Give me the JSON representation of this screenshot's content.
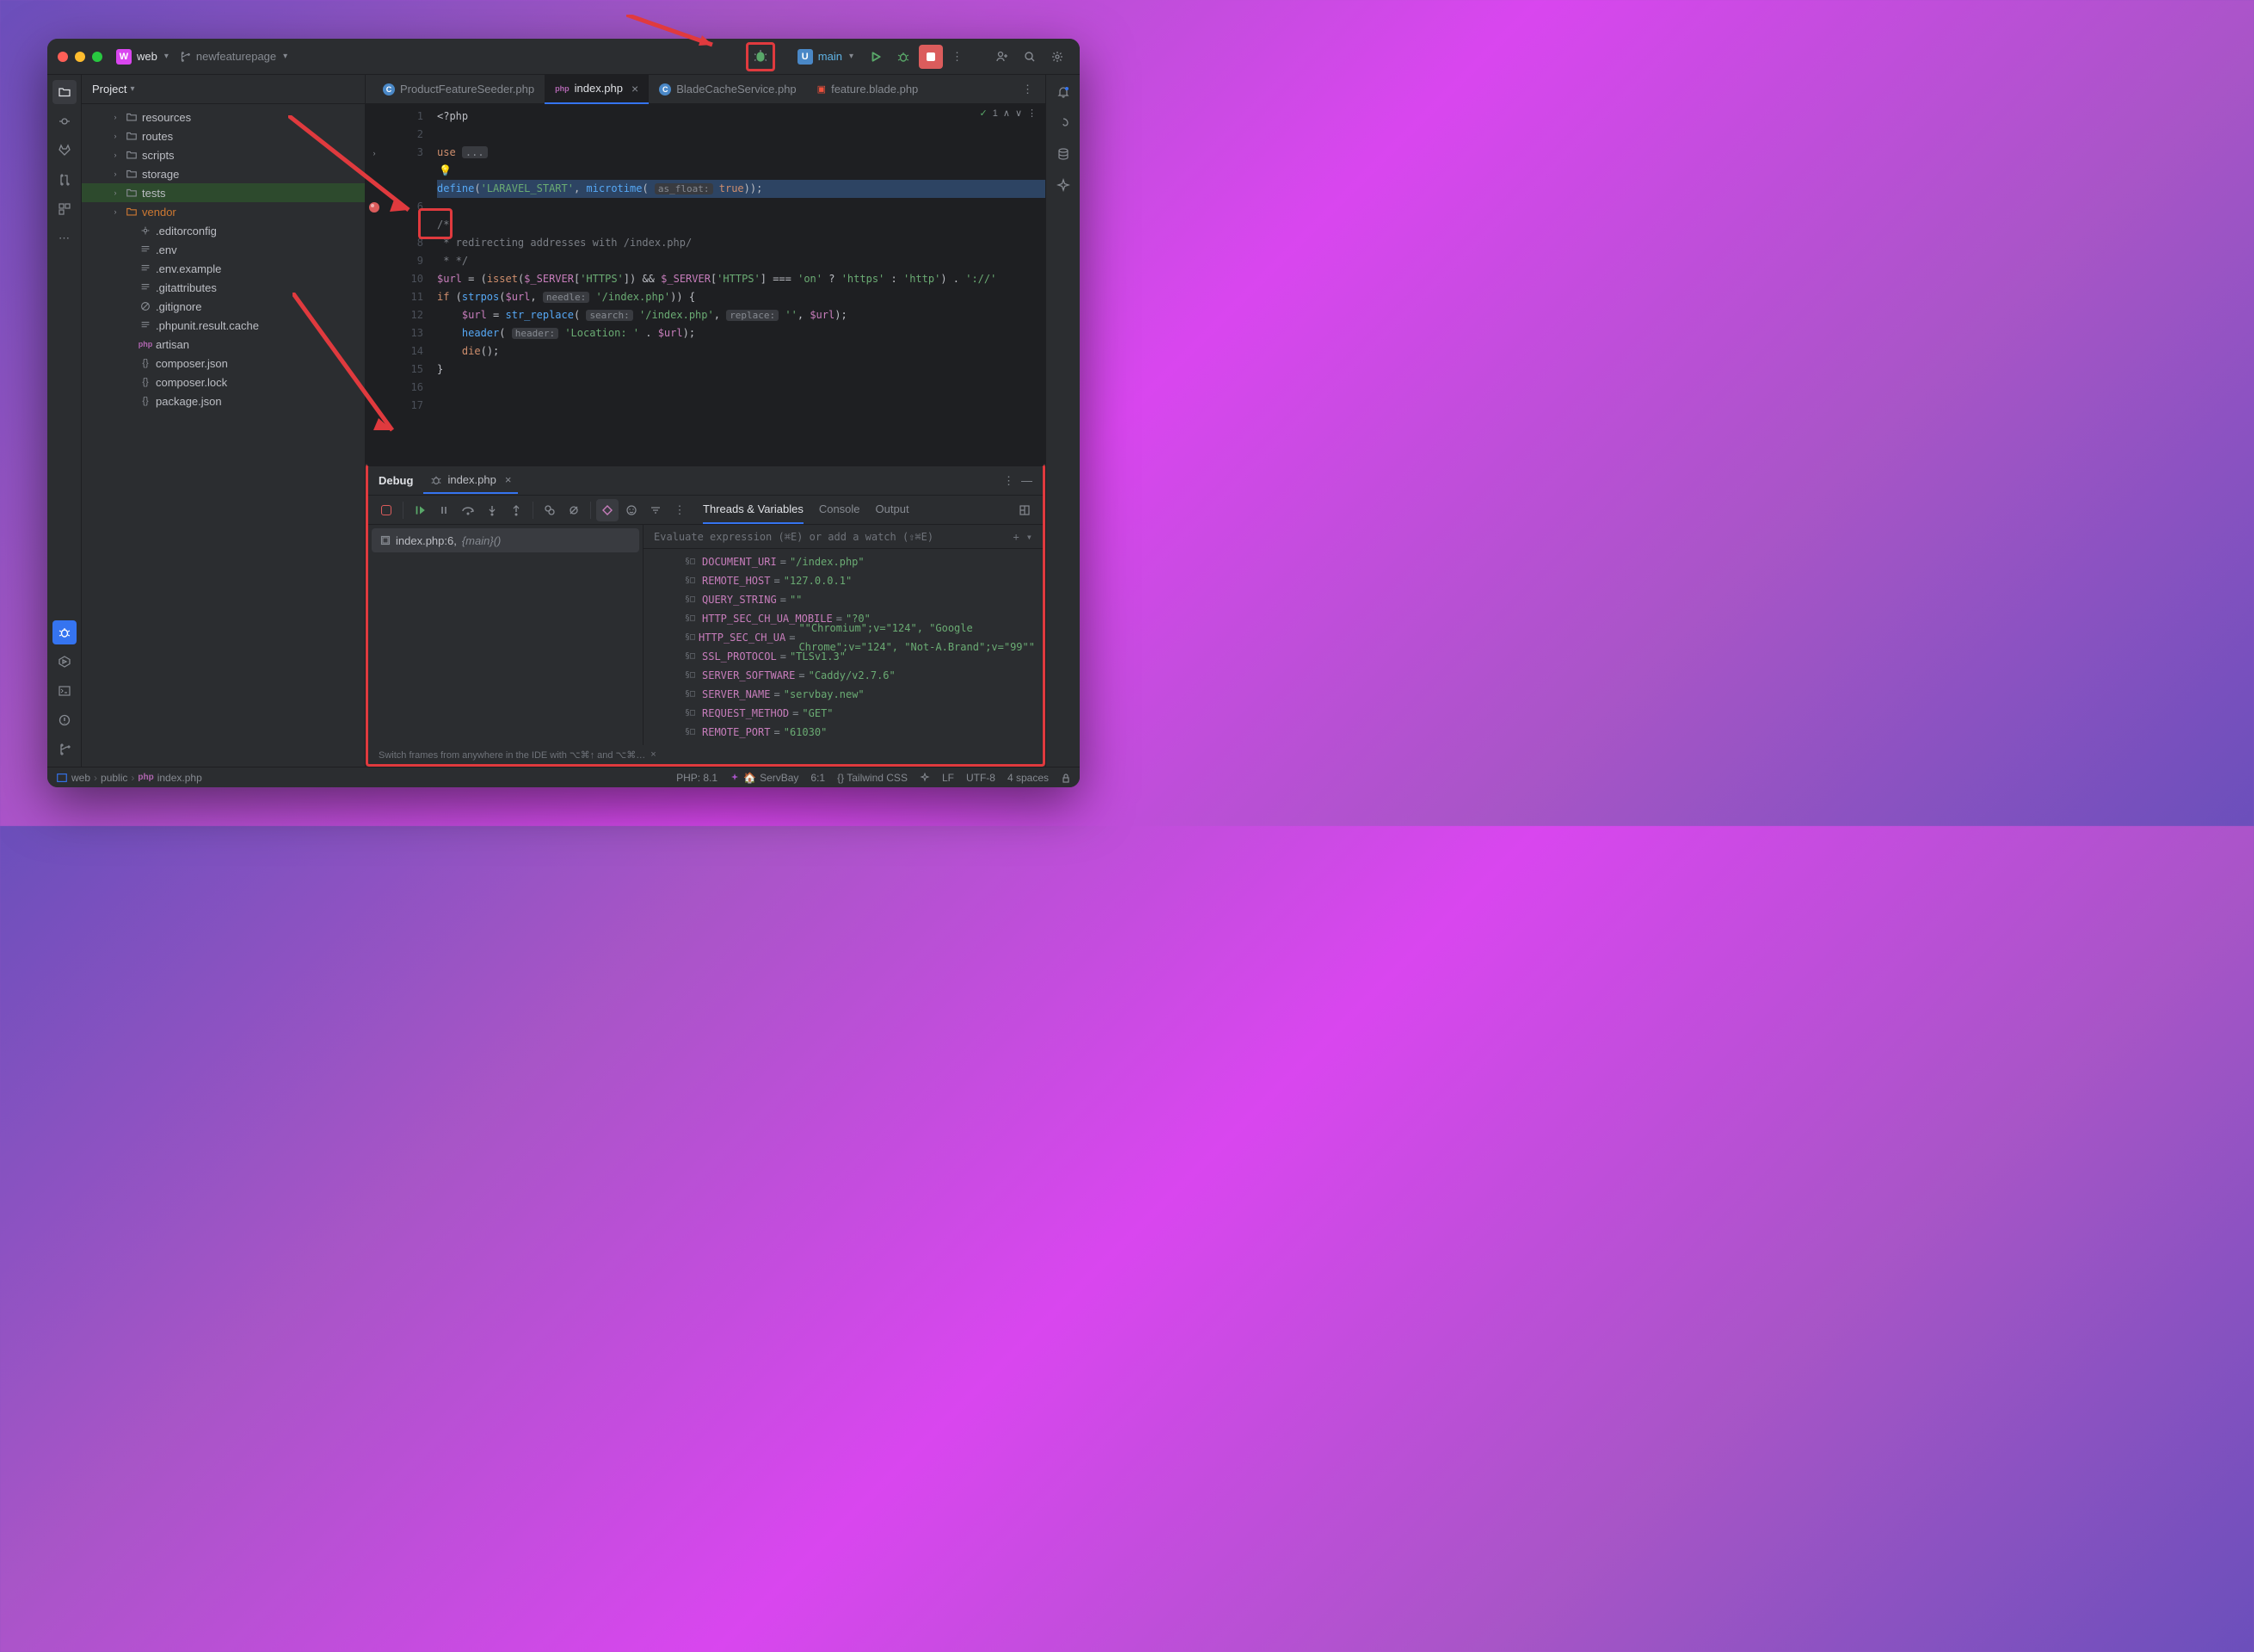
{
  "header": {
    "project_letter": "W",
    "project_name": "web",
    "branch": "newfeaturepage",
    "run_config_name": "main"
  },
  "project_panel": {
    "title": "Project",
    "tree": [
      {
        "name": "resources",
        "type": "folder",
        "indent": 1,
        "expandable": true
      },
      {
        "name": "routes",
        "type": "folder",
        "indent": 1,
        "expandable": true
      },
      {
        "name": "scripts",
        "type": "folder",
        "indent": 1,
        "expandable": true
      },
      {
        "name": "storage",
        "type": "folder",
        "indent": 1,
        "expandable": true
      },
      {
        "name": "tests",
        "type": "folder",
        "indent": 1,
        "expandable": true,
        "selected": true
      },
      {
        "name": "vendor",
        "type": "folder",
        "indent": 1,
        "expandable": true,
        "vendor": true
      },
      {
        "name": ".editorconfig",
        "type": "file",
        "icon": "gear",
        "indent": 2
      },
      {
        "name": ".env",
        "type": "file",
        "icon": "lines",
        "indent": 2
      },
      {
        "name": ".env.example",
        "type": "file",
        "icon": "lines",
        "indent": 2
      },
      {
        "name": ".gitattributes",
        "type": "file",
        "icon": "lines",
        "indent": 2
      },
      {
        "name": ".gitignore",
        "type": "file",
        "icon": "gitignore",
        "indent": 2
      },
      {
        "name": ".phpunit.result.cache",
        "type": "file",
        "icon": "lines",
        "indent": 2
      },
      {
        "name": "artisan",
        "type": "file",
        "icon": "php",
        "indent": 2
      },
      {
        "name": "composer.json",
        "type": "file",
        "icon": "braces",
        "indent": 2
      },
      {
        "name": "composer.lock",
        "type": "file",
        "icon": "braces",
        "indent": 2
      },
      {
        "name": "package.json",
        "type": "file",
        "icon": "braces",
        "indent": 2
      }
    ]
  },
  "tabs": [
    {
      "name": "ProductFeatureSeeder.php",
      "icon": "class",
      "active": false,
      "closable": false
    },
    {
      "name": "index.php",
      "icon": "php",
      "active": true,
      "closable": true
    },
    {
      "name": "BladeCacheService.php",
      "icon": "class",
      "active": false,
      "closable": false
    },
    {
      "name": "feature.blade.php",
      "icon": "blade",
      "active": false,
      "closable": false
    }
  ],
  "editor_meta": {
    "green_check": "1",
    "up": "∧",
    "down": "∨"
  },
  "editor": {
    "line_numbers": [
      "1",
      "2",
      "3",
      "",
      "",
      "6",
      "",
      "8",
      "9",
      "10",
      "11",
      "12",
      "13",
      "14",
      "15",
      "16",
      "17",
      ""
    ],
    "lines": [
      {
        "raw": "<?php",
        "type": "open"
      },
      {
        "raw": "",
        "type": "blank"
      },
      {
        "raw": "use ...",
        "type": "fold"
      },
      {
        "raw": "bulb",
        "type": "bulb"
      },
      {
        "raw": "define('LARAVEL_START', microtime( as_float: true));",
        "type": "hl"
      },
      {
        "raw": "",
        "type": "blank"
      },
      {
        "raw": "/*",
        "type": "comment"
      },
      {
        "raw": " * redirecting addresses with /index.php/",
        "type": "comment"
      },
      {
        "raw": " * */",
        "type": "comment"
      },
      {
        "raw": "$url = (isset($_SERVER['HTTPS']) && $_SERVER['HTTPS'] === 'on' ? 'https' : 'http') . '://'",
        "type": "code1"
      },
      {
        "raw": "if (strpos($url, needle: '/index.php')) {",
        "type": "code2"
      },
      {
        "raw": "    $url = str_replace( search: '/index.php', replace: '', $url);",
        "type": "code3"
      },
      {
        "raw": "    header( header: 'Location: ' . $url);",
        "type": "code4"
      },
      {
        "raw": "    die();",
        "type": "code5"
      },
      {
        "raw": "}",
        "type": "code6"
      },
      {
        "raw": "",
        "type": "blank"
      },
      {
        "raw": "",
        "type": "blank"
      }
    ]
  },
  "debug": {
    "title": "Debug",
    "session_name": "index.php",
    "tabs": [
      "Threads & Variables",
      "Console",
      "Output"
    ],
    "active_tab": 0,
    "frame": {
      "file": "index.php:6,",
      "fn": "{main}()"
    },
    "eval_placeholder": "Evaluate expression (⌘E) or add a watch (⇧⌘E)",
    "variables": [
      {
        "name": "DOCUMENT_URI",
        "value": "\"/index.php\""
      },
      {
        "name": "REMOTE_HOST",
        "value": "\"127.0.0.1\""
      },
      {
        "name": "QUERY_STRING",
        "value": "\"\""
      },
      {
        "name": "HTTP_SEC_CH_UA_MOBILE",
        "value": "\"?0\""
      },
      {
        "name": "HTTP_SEC_CH_UA",
        "value": "\"\"Chromium\";v=\"124\", \"Google Chrome\";v=\"124\", \"Not-A.Brand\";v=\"99\"\""
      },
      {
        "name": "SSL_PROTOCOL",
        "value": "\"TLSv1.3\""
      },
      {
        "name": "SERVER_SOFTWARE",
        "value": "\"Caddy/v2.7.6\""
      },
      {
        "name": "SERVER_NAME",
        "value": "\"servbay.new\""
      },
      {
        "name": "REQUEST_METHOD",
        "value": "\"GET\""
      },
      {
        "name": "REMOTE_PORT",
        "value": "\"61030\""
      }
    ],
    "footer_hint": "Switch frames from anywhere in the IDE with ⌥⌘↑ and ⌥⌘…"
  },
  "status": {
    "breadcrumb": [
      "web",
      "public",
      "index.php"
    ],
    "php": "PHP: 8.1",
    "servbay": "ServBay",
    "pos": "6:1",
    "tailwind": "Tailwind CSS",
    "lf": "LF",
    "encoding": "UTF-8",
    "indent": "4 spaces"
  }
}
